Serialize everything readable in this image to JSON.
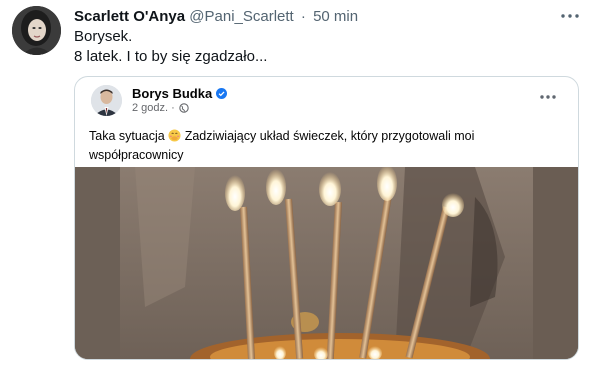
{
  "tweet": {
    "author_name": "Scarlett O'Anya",
    "author_handle": "@Pani_Scarlett",
    "separator": "·",
    "time": "50 min",
    "text_lines": [
      "Borysek.",
      "8 latek. I to by się zgadzało..."
    ]
  },
  "embedded_post": {
    "author_name": "Borys Budka",
    "time": "2 godz.",
    "separator": "·",
    "text": "Taka sytuacja",
    "text_rest": "Zadziwiający układ świeczek, który przygotowali moi współpracownicy",
    "icons": {
      "verified": "verified-badge-icon",
      "privacy": "globe-icon",
      "more": "more-icon",
      "emoji_1": "smiling-face-with-hand-over-mouth-emoji",
      "emoji_2": "winking-face-emoji"
    }
  },
  "colors": {
    "text_primary": "#0f1419",
    "text_secondary": "#536471",
    "border": "#cfd9de",
    "verified_blue": "#1877f2",
    "candle_gold": "#c9a070"
  }
}
